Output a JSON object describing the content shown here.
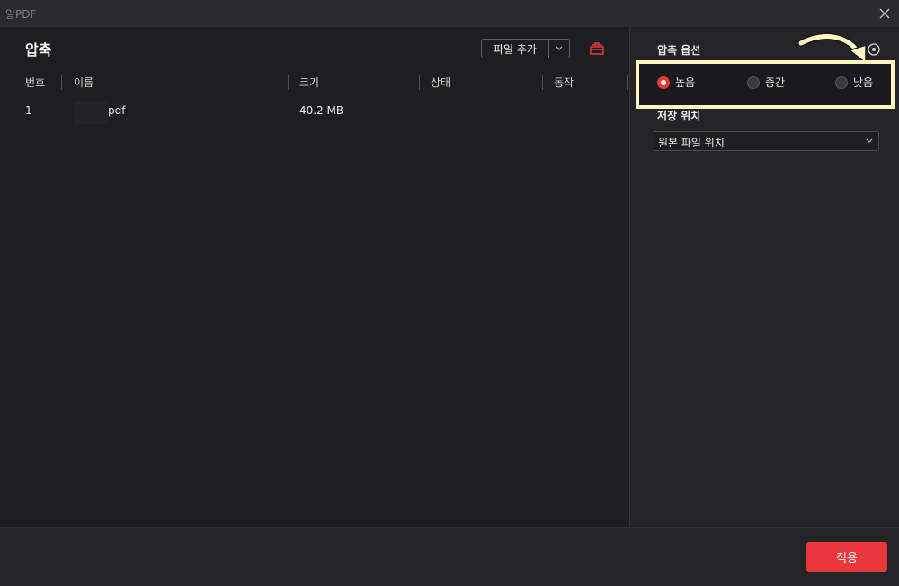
{
  "window": {
    "title": "알PDF"
  },
  "main": {
    "title": "압축",
    "add_file_label": "파일 추가",
    "columns": [
      "번호",
      "이름",
      "크기",
      "상태",
      "동작"
    ],
    "rows": [
      {
        "number": "1",
        "name": "pdf",
        "size": "40.2 MB",
        "status": "",
        "action": ""
      }
    ]
  },
  "options": {
    "title": "압축 옵션",
    "levels": [
      {
        "label": "높음",
        "selected": true
      },
      {
        "label": "중간",
        "selected": false
      },
      {
        "label": "낮음",
        "selected": false
      }
    ],
    "save_location_label": "저장 위치",
    "save_location_value": "원본 파일 위치"
  },
  "footer": {
    "apply_label": "적용"
  },
  "colors": {
    "accent": "#e8383d",
    "highlight_border": "#fbf5bf"
  },
  "icons": [
    "close-icon",
    "chevron-down-icon",
    "trash-icon",
    "settings-icon",
    "arrow-annotation-icon"
  ]
}
